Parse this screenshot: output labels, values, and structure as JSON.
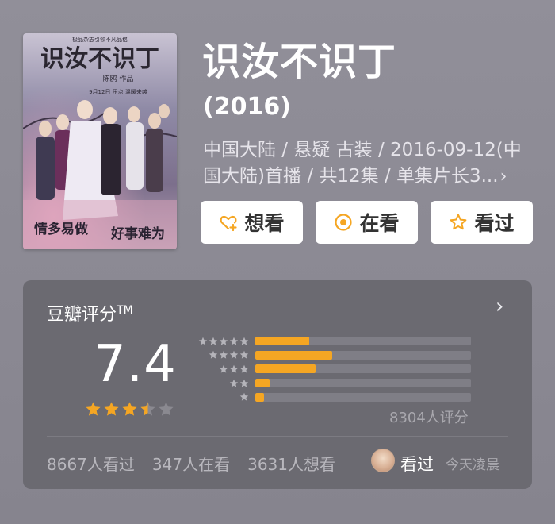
{
  "movie": {
    "title": "识汝不识丁",
    "year": "(2016)",
    "meta_line1": "中国大陆 / 悬疑 古装 / 2016-09-12(中",
    "meta_line2": "国大陆)首播 / 共12集 / 单集片长3...",
    "meta_chevron": "›",
    "poster": {
      "top_caption": "极品杂志引领不凡品格",
      "title_art": "识汝不识丁",
      "producer": "陈鸥 作品",
      "date_line": "9月12日 乐点 温暖来袭",
      "slogan_left": "情多易做",
      "slogan_right": "好事难为"
    }
  },
  "actions": [
    {
      "label": "想看",
      "icon": "heart-plus-icon"
    },
    {
      "label": "在看",
      "icon": "target-circle-icon"
    },
    {
      "label": "看过",
      "icon": "star-outline-icon"
    }
  ],
  "rating": {
    "title": "豆瓣评分",
    "tm": "TM",
    "chevron": "›",
    "score": "7.4",
    "stars": 3.5,
    "distribution": [
      {
        "stars": 5,
        "fraction": 0.25
      },
      {
        "stars": 4,
        "fraction": 0.355
      },
      {
        "stars": 3,
        "fraction": 0.28
      },
      {
        "stars": 2,
        "fraction": 0.065
      },
      {
        "stars": 1,
        "fraction": 0.04
      }
    ],
    "count": "8304人评分"
  },
  "stats": {
    "watched": "8667人看过",
    "watching": "347人在看",
    "want": "3631人想看"
  },
  "friend": {
    "action": "看过",
    "time": "今天凌晨"
  },
  "colors": {
    "accent": "#f5a623",
    "card_bg": "#6b6a71",
    "empty_star": "#8a8990"
  }
}
